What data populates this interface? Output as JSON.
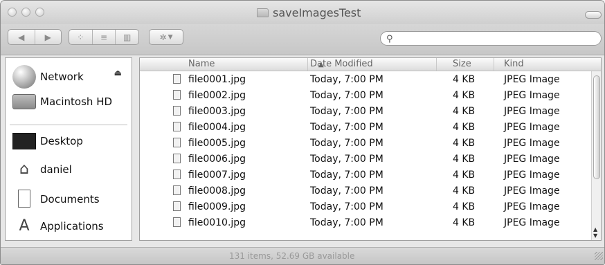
{
  "window": {
    "title": "saveImagesTest"
  },
  "toolbar": {
    "back_icon": "back-arrow-icon",
    "forward_icon": "forward-arrow-icon",
    "view_icons": [
      "icon-view-icon",
      "list-view-icon",
      "column-view-icon"
    ],
    "action_icon": "gear-icon",
    "search": {
      "placeholder": "",
      "value": ""
    }
  },
  "sidebar": {
    "items": [
      {
        "label": "Network",
        "icon": "globe-icon",
        "eject": true
      },
      {
        "label": "Macintosh HD",
        "icon": "hard-drive-icon"
      },
      {
        "label": "Desktop",
        "icon": "desktop-icon"
      },
      {
        "label": "daniel",
        "icon": "home-icon"
      },
      {
        "label": "Documents",
        "icon": "document-icon"
      },
      {
        "label": "Applications",
        "icon": "applications-icon"
      }
    ]
  },
  "file_list": {
    "headers": {
      "name": "Name",
      "date": "Date Modified",
      "size": "Size",
      "kind": "Kind"
    },
    "sort_indicator": "▲",
    "rows": [
      {
        "name": "file0001.jpg",
        "date": "Today, 7:00 PM",
        "size": "4 KB",
        "kind": "JPEG Image"
      },
      {
        "name": "file0002.jpg",
        "date": "Today, 7:00 PM",
        "size": "4 KB",
        "kind": "JPEG Image"
      },
      {
        "name": "file0003.jpg",
        "date": "Today, 7:00 PM",
        "size": "4 KB",
        "kind": "JPEG Image"
      },
      {
        "name": "file0004.jpg",
        "date": "Today, 7:00 PM",
        "size": "4 KB",
        "kind": "JPEG Image"
      },
      {
        "name": "file0005.jpg",
        "date": "Today, 7:00 PM",
        "size": "4 KB",
        "kind": "JPEG Image"
      },
      {
        "name": "file0006.jpg",
        "date": "Today, 7:00 PM",
        "size": "4 KB",
        "kind": "JPEG Image"
      },
      {
        "name": "file0007.jpg",
        "date": "Today, 7:00 PM",
        "size": "4 KB",
        "kind": "JPEG Image"
      },
      {
        "name": "file0008.jpg",
        "date": "Today, 7:00 PM",
        "size": "4 KB",
        "kind": "JPEG Image"
      },
      {
        "name": "file0009.jpg",
        "date": "Today, 7:00 PM",
        "size": "4 KB",
        "kind": "JPEG Image"
      },
      {
        "name": "file0010.jpg",
        "date": "Today, 7:00 PM",
        "size": "4 KB",
        "kind": "JPEG Image"
      }
    ]
  },
  "status": {
    "text": "131 items, 52.69 GB available"
  }
}
